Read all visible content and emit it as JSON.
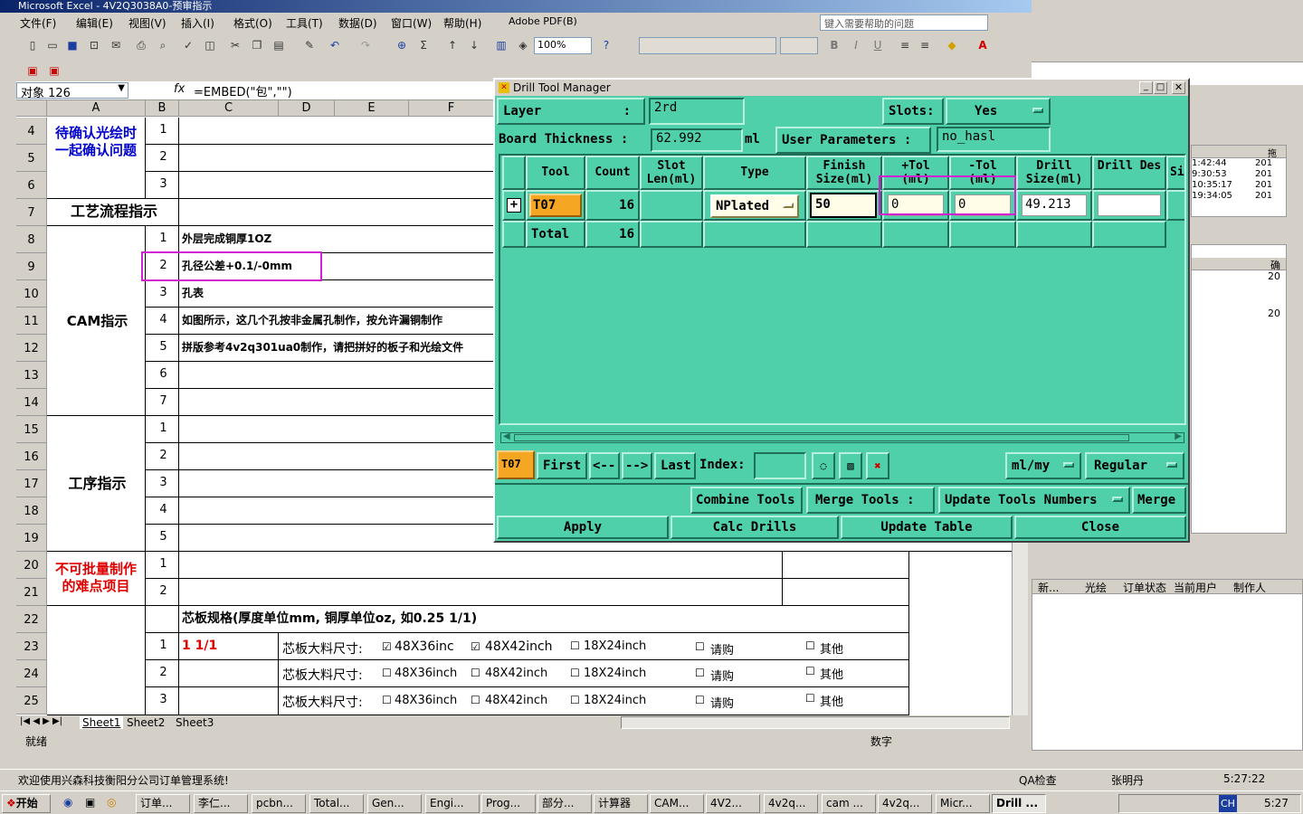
{
  "excel": {
    "title": "Microsoft Excel - 4V2Q3038A0-预审指示",
    "menus": [
      "文件(F)",
      "编辑(E)",
      "视图(V)",
      "插入(I)",
      "格式(O)",
      "工具(T)",
      "数据(D)",
      "窗口(W)",
      "帮助(H)",
      "Adobe PDF(B)"
    ],
    "ask_placeholder": "键入需要帮助的问题",
    "zoom": "100%",
    "namebox": "对象 126",
    "formula": "=EMBED(\"包\",\"\")",
    "col_headers": [
      "A",
      "B",
      "C",
      "D",
      "E",
      "F"
    ],
    "row_numbers": [
      "4",
      "5",
      "6",
      "7",
      "8",
      "9",
      "10",
      "11",
      "12",
      "13",
      "14",
      "15",
      "16",
      "17",
      "18",
      "19",
      "20",
      "21",
      "22",
      "23",
      "24",
      "25"
    ],
    "cells": {
      "pending_confirm": "待确认光绘时一起确认问题",
      "process_flow": "工艺流程指示",
      "cam_instr": "CAM指示",
      "process_instr": "工序指示",
      "difficult": "不可批量制作的难点项目",
      "r8": "外层完成铜厚1OZ",
      "r9": "孔径公差+0.1/-0mm",
      "r10": "孔表",
      "r11": "如图所示，这几个孔按非金属孔制作，按允许漏铜制作",
      "r12": "拼版参考4v2q301ua0制作，请把拼好的板子和光绘文件",
      "r22": "芯板规格(厚度单位mm, 铜厚单位oz, 如0.25 1/1)",
      "r23_b": "1 1/1",
      "core_label": "芯板大料尺寸:",
      "opt1": "48X36inc",
      "opt1b": "48X36inch",
      "opt2": "48X42inch",
      "opt3": "18X24inch",
      "opt4": "请购",
      "opt5": "其他",
      "nums_a": [
        "1",
        "2",
        "3"
      ],
      "nums_b": [
        "1",
        "2",
        "3",
        "4",
        "5",
        "6",
        "7"
      ],
      "nums_c": [
        "1",
        "2",
        "3",
        "4",
        "5"
      ],
      "nums_d": [
        "1",
        "2"
      ],
      "nums_e": [
        "1",
        "2",
        "3"
      ]
    },
    "sheets": [
      "Sheet1",
      "Sheet2",
      "Sheet3"
    ],
    "status_ready": "就绪",
    "status_num": "数字"
  },
  "dialog": {
    "title": "Drill Tool Manager",
    "layer_label": "Layer",
    "layer_colon": ":",
    "layer_value": "2rd",
    "slots_label": "Slots:",
    "slots_value": "Yes",
    "board_thickness_label": "Board Thickness :",
    "board_thickness_value": "62.992",
    "board_unit": "ml",
    "user_params_label": "User Parameters :",
    "user_params_value": "no_hasl",
    "columns": [
      "Tool",
      "Count",
      "Slot Len(ml)",
      "Type",
      "Finish Size(ml)",
      "+Tol (ml)",
      "-Tol (ml)",
      "Drill Size(ml)",
      "Drill Des",
      "Si"
    ],
    "row": {
      "tool": "T07",
      "count": "16",
      "type": "NPlated",
      "finish": "50",
      "ptol": "0",
      "mtol": "0",
      "drill": "49.213",
      "des": ""
    },
    "total_label": "Total",
    "total_count": "16",
    "nav": {
      "current": "T07",
      "first": "First",
      "prev": "<--",
      "next": "-->",
      "last": "Last",
      "index_label": "Index:",
      "units": "ml/my",
      "mode": "Regular"
    },
    "buttons": {
      "combine": "Combine Tools",
      "merge_label": "Merge Tools :",
      "update_numbers": "Update Tools Numbers",
      "merge": "Merge",
      "apply": "Apply",
      "calc": "Calc Drills",
      "update_table": "Update Table",
      "close": "Close"
    }
  },
  "rightapp": {
    "times": [
      "1:42:44",
      "9:30:53",
      "10:35:17",
      "19:34:05"
    ],
    "col_short": "201",
    "hdr1": "拖",
    "hdr2": "确",
    "val20": "20",
    "headers": [
      "新...",
      "光绘",
      "订单状态",
      "当前用户",
      "制作人"
    ]
  },
  "app_status": {
    "welcome": "欢迎使用兴森科技衡阳分公司订单管理系统!",
    "qa": "QA检查",
    "user": "张明丹",
    "time": "5:27:22"
  },
  "taskbar": {
    "start": "开始",
    "tasks": [
      "订单...",
      "李仁...",
      "pcbn...",
      "Total...",
      "Gen...",
      "Engi...",
      "Prog...",
      "部分...",
      "计算器",
      "CAM...",
      "4V2...",
      "4v2q...",
      "cam ...",
      "4v2q...",
      "Micr...",
      "Drill ..."
    ],
    "lang": "CH",
    "clock": "5:27"
  }
}
